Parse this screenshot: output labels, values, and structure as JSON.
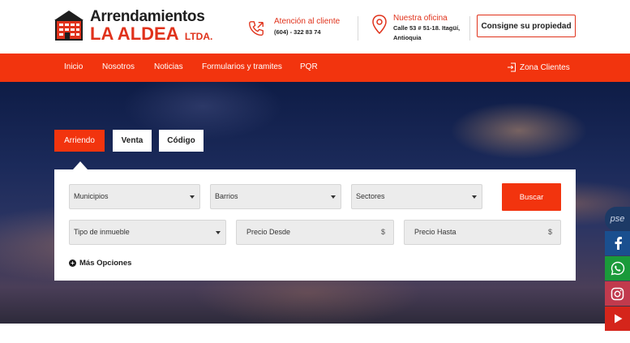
{
  "brand": {
    "name_line1": "Arrendamientos",
    "name_line2": "LA ALDEA",
    "name_suffix": "LTDA."
  },
  "contact": {
    "title": "Atención al cliente",
    "phone": "(604) - 322 83 74"
  },
  "office": {
    "title": "Nuestra oficina",
    "address_line1": "Calle 53 # 51-18. Itagüí,",
    "address_line2": "Antioquia"
  },
  "header": {
    "consign_label": "Consigne su propiedad"
  },
  "nav": {
    "items": [
      "Inicio",
      "Nosotros",
      "Noticias",
      "Formularios y tramites",
      "PQR"
    ],
    "client_zone": "Zona Clientes"
  },
  "search": {
    "tabs": [
      "Arriendo",
      "Venta",
      "Código"
    ],
    "active_tab": "Arriendo",
    "municipios": "Municipios",
    "barrios": "Barrios",
    "sectores": "Sectores",
    "tipo_inmueble": "Tipo de inmueble",
    "precio_desde": "Precio Desde",
    "precio_hasta": "Precio Hasta",
    "currency_symbol": "$",
    "search_button": "Buscar",
    "more_options": "Más Opciones"
  },
  "social": {
    "pse": "pse",
    "icons": [
      "facebook-icon",
      "whatsapp-icon",
      "instagram-icon",
      "youtube-icon"
    ]
  },
  "colors": {
    "accent": "#f2340e",
    "brand_red": "#e0321b",
    "facebook": "#1a4f8f",
    "whatsapp": "#1a9a3a",
    "instagram": "#c13a4d",
    "youtube": "#d5251b",
    "pse": "#1d3a66"
  }
}
